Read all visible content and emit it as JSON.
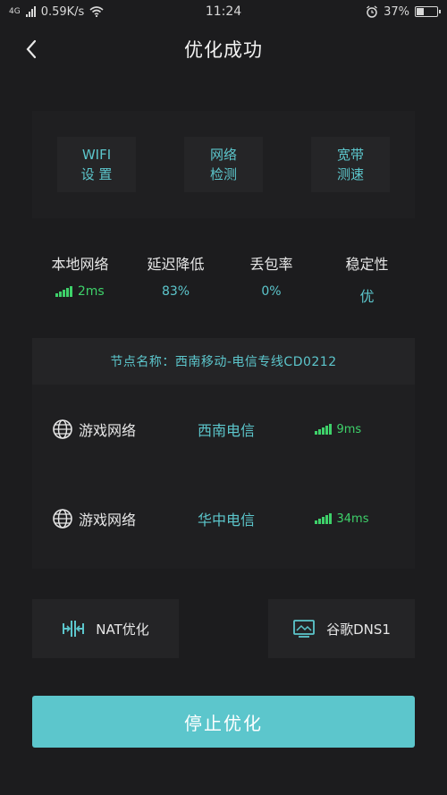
{
  "status_bar": {
    "network_type": "4G",
    "speed": "0.59K/s",
    "time": "11:24",
    "battery": "37%",
    "battery_level": 0.37
  },
  "header": {
    "title": "优化成功"
  },
  "tools": [
    {
      "line1": "WIFI",
      "line2": "设 置"
    },
    {
      "line1": "网络",
      "line2": "检测"
    },
    {
      "line1": "宽带",
      "line2": "测速"
    }
  ],
  "stats": [
    {
      "label": "本地网络",
      "value": "2ms"
    },
    {
      "label": "延迟降低",
      "value": "83%"
    },
    {
      "label": "丢包率",
      "value": "0%"
    },
    {
      "label": "稳定性",
      "value": "优"
    }
  ],
  "node": {
    "title": "节点名称：西南移动-电信专线CD0212",
    "routes": [
      {
        "label": "游戏网络",
        "isp": "西南电信",
        "latency": "9ms"
      },
      {
        "label": "游戏网络",
        "isp": "华中电信",
        "latency": "34ms"
      }
    ]
  },
  "features": {
    "nat": "NAT优化",
    "dns": "谷歌DNS1"
  },
  "stop_button": "停止优化",
  "colors": {
    "accent": "#5cc6cc",
    "good": "#3ed16a",
    "background": "#1c1c1e"
  }
}
